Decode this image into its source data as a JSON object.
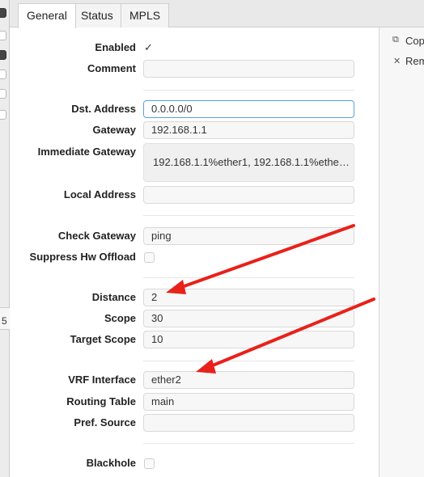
{
  "tabs": [
    {
      "label": "General",
      "active": true
    },
    {
      "label": "Status",
      "active": false
    },
    {
      "label": "MPLS",
      "active": false
    }
  ],
  "form": {
    "enabled_label": "Enabled",
    "enabled_checked": true,
    "comment_label": "Comment",
    "comment_value": "",
    "dst_address_label": "Dst. Address",
    "dst_address_value": "0.0.0.0/0",
    "gateway_label": "Gateway",
    "gateway_value": "192.168.1.1",
    "immediate_gateway_label": "Immediate Gateway",
    "immediate_gateway_value": "192.168.1.1%ether1, 192.168.1.1%ethe…",
    "local_address_label": "Local Address",
    "local_address_value": "",
    "check_gateway_label": "Check Gateway",
    "check_gateway_value": "ping",
    "suppress_hw_offload_label": "Suppress Hw Offload",
    "suppress_hw_offload_checked": false,
    "distance_label": "Distance",
    "distance_value": "2",
    "scope_label": "Scope",
    "scope_value": "30",
    "target_scope_label": "Target Scope",
    "target_scope_value": "10",
    "vrf_interface_label": "VRF Interface",
    "vrf_interface_value": "ether2",
    "routing_table_label": "Routing Table",
    "routing_table_value": "main",
    "pref_source_label": "Pref. Source",
    "pref_source_value": "",
    "blackhole_label": "Blackhole",
    "blackhole_checked": false
  },
  "side": {
    "copy_label": "Cop",
    "remove_label": "Rem"
  },
  "left_strip": {
    "number": "5"
  },
  "colors": {
    "accent_focus": "#5ea0d8",
    "arrow": "#e8211b"
  }
}
